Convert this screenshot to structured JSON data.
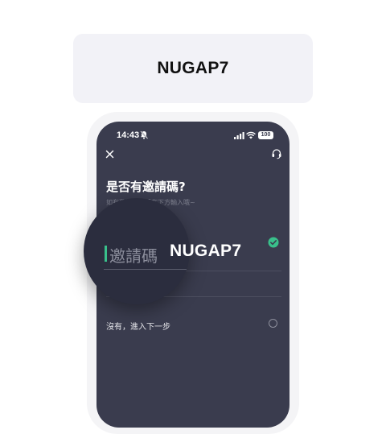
{
  "header_card": {
    "code": "NUGAP7"
  },
  "status_bar": {
    "time": "14:43",
    "battery": "100"
  },
  "screen": {
    "title": "是否有邀請碼?",
    "subtitle": "如有邀請碼，請在下方輸入哦~",
    "invite_input": {
      "placeholder": "邀請碼",
      "value": "NUGAP7",
      "valid": true
    },
    "skip_option": {
      "label": "沒有，進入下一步",
      "selected": false
    }
  },
  "colors": {
    "accent": "#39c08b",
    "screen_bg": "#3a3c4e",
    "card_bg": "#f2f2f7"
  },
  "icons": [
    "mute-icon",
    "signal-icon",
    "wifi-icon",
    "close-icon",
    "support-icon",
    "check-icon"
  ]
}
